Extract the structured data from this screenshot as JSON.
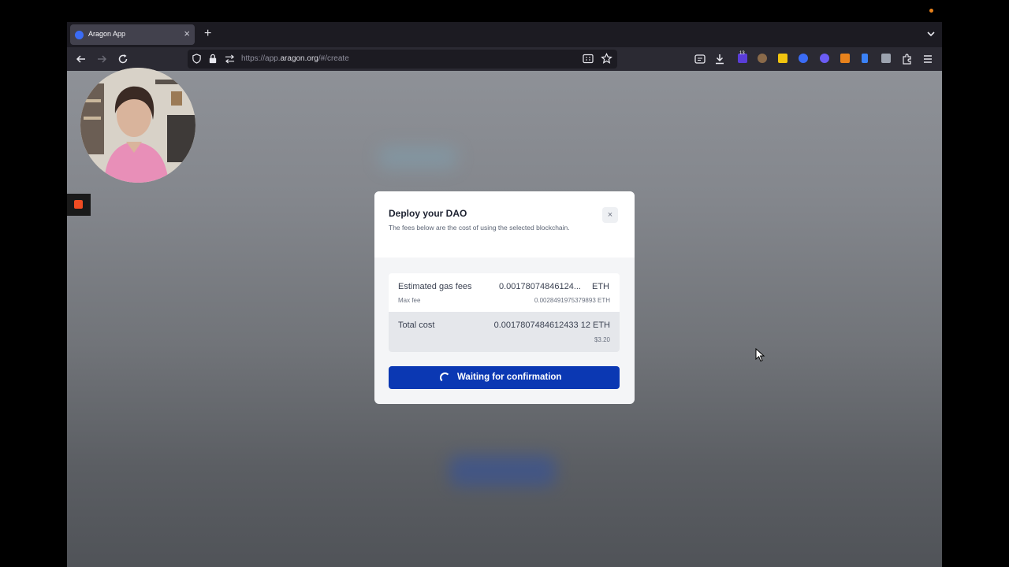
{
  "browser": {
    "tab": {
      "title": "Aragon App"
    },
    "url": {
      "prefix": "https://app.",
      "domain": "aragon.org",
      "path": "/#/create"
    },
    "extensions": [
      {
        "name": "extension-purple-icon",
        "color": "#5a3dd8"
      },
      {
        "name": "extension-monkey-icon",
        "color": "#8a6a4a"
      },
      {
        "name": "extension-yellow-icon",
        "color": "#f1c40f"
      },
      {
        "name": "extension-blue-circle-icon",
        "color": "#3b6cf5"
      },
      {
        "name": "extension-violet-icon",
        "color": "#6b5cf5"
      },
      {
        "name": "metamask-icon",
        "color": "#e8821c"
      },
      {
        "name": "extension-bookmark-icon",
        "color": "#3b82f6"
      },
      {
        "name": "extension-reader-icon",
        "color": "#9ca3af"
      }
    ],
    "extension_badge": "13"
  },
  "modal": {
    "title": "Deploy your DAO",
    "description": "The fees below are the cost of using the selected blockchain.",
    "close": "×",
    "estimated_gas_label": "Estimated gas fees",
    "estimated_gas_value": "0.00178074846124...",
    "estimated_gas_unit": "ETH",
    "max_fee_label": "Max fee",
    "max_fee_value": "0.0028491975379893 ETH",
    "total_cost_label": "Total cost",
    "total_cost_value": "0.0017807484612433 12 ETH",
    "total_cost_usd": "$3.20",
    "button_label": "Waiting for confirmation"
  },
  "colors": {
    "primary": "#0b38b3",
    "rec_stop": "#f04c23"
  }
}
